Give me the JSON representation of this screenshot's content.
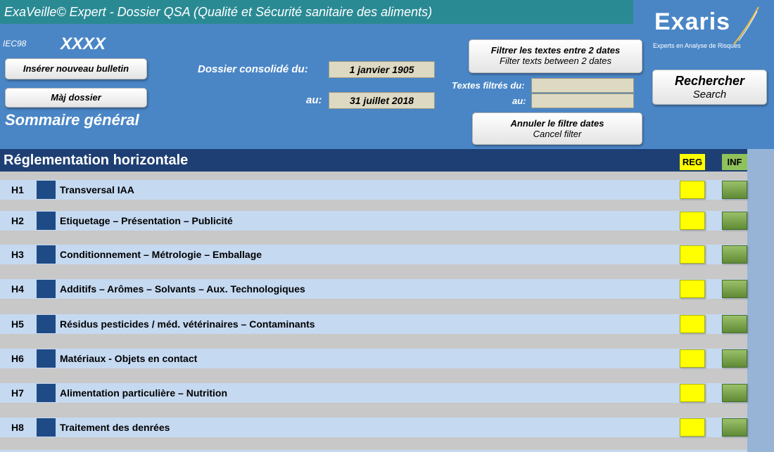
{
  "header": {
    "title": "ExaVeille© Expert - Dossier QSA (Qualité et Sécurité sanitaire des aliments)",
    "code": "IEC98",
    "user": "XXXX",
    "logo_name": "Exaris",
    "logo_tagline": "Experts en Analyse de Risques",
    "insert_button": "Insérer nouveau bulletin",
    "update_button": "Màj dossier",
    "consolidated_label": "Dossier consolidé du:",
    "consolidated_from": "1 janvier 1905",
    "to_label": "au:",
    "consolidated_to": "31 juillet 2018",
    "filter_button_l1": "Filtrer les textes  entre 2 dates",
    "filter_button_l2": "Filter texts between 2 dates",
    "filtered_label": "Textes filtrés du:",
    "filtered_to_label": "au:",
    "cancel_button_l1": "Annuler le filtre dates",
    "cancel_button_l2": "Cancel filter",
    "search_button_l1": "Rechercher",
    "search_button_l2": "Search",
    "summary": "Sommaire général"
  },
  "section": {
    "title": "Réglementation horizontale",
    "reg_label": "REG",
    "inf_label": "INF",
    "rows": [
      {
        "code": "H1",
        "label": "Transversal IAA"
      },
      {
        "code": "H2",
        "label": "Etiquetage – Présentation – Publicité"
      },
      {
        "code": "H3",
        "label": "Conditionnement – Métrologie – Emballage"
      },
      {
        "code": "H4",
        "label": "Additifs – Arômes – Solvants – Aux. Technologiques"
      },
      {
        "code": "H5",
        "label": "Résidus pesticides / méd. vétérinaires – Contaminants"
      },
      {
        "code": "H6",
        "label": "Matériaux - Objets en contact"
      },
      {
        "code": "H7",
        "label": "Alimentation particulière – Nutrition"
      },
      {
        "code": "H8",
        "label": "Traitement des denrées"
      }
    ]
  },
  "colors": {
    "background": "#4a86c6",
    "title_bar": "#2a8a94",
    "section_header": "#1e3f74",
    "row_bg": "#c5d9f1",
    "reg": "#ffff00",
    "inf": "#8fc25a"
  }
}
